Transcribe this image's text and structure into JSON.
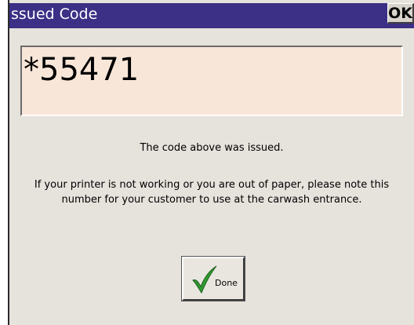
{
  "window": {
    "title": "ssued Code",
    "ok_label": "OK"
  },
  "code": {
    "value": "*55471"
  },
  "messages": {
    "issued": "The code above was issued.",
    "printer": "If your printer is not working or you are out of paper, please note this number for your customer to use at the carwash entrance."
  },
  "done_button": {
    "label": "Done",
    "icon": "checkmark-icon"
  },
  "colors": {
    "titlebar": "#3b2f86",
    "code_background": "#f8e6d8",
    "checkmark": "#2f9a2f"
  }
}
